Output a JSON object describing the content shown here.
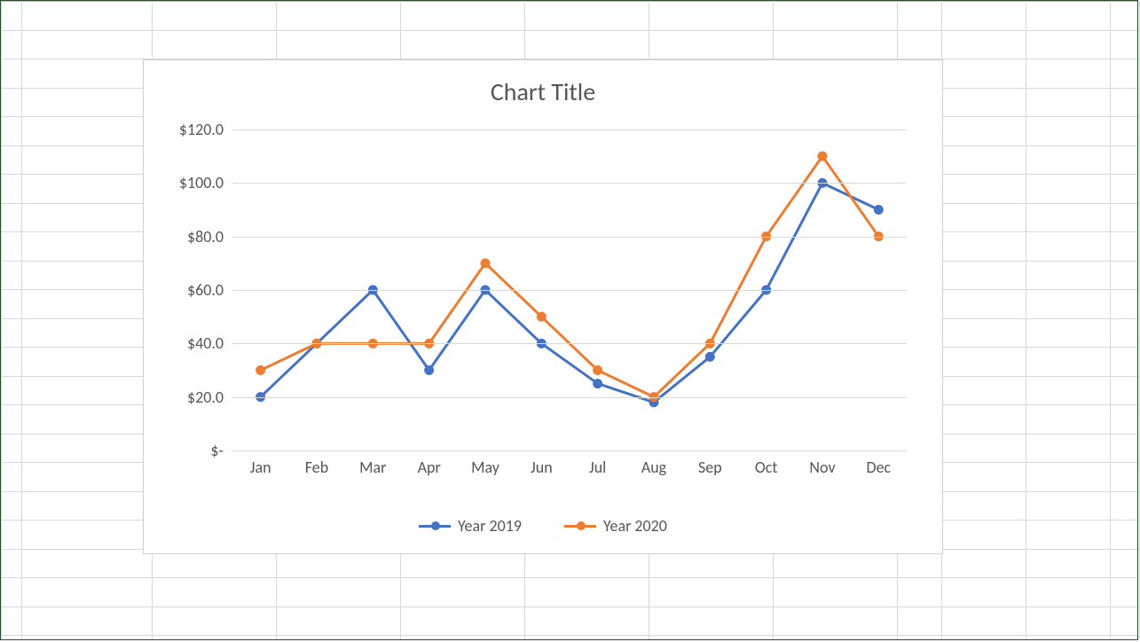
{
  "chart_data": {
    "type": "line",
    "title": "Chart Title",
    "xlabel": "",
    "ylabel": "",
    "categories": [
      "Jan",
      "Feb",
      "Mar",
      "Apr",
      "May",
      "Jun",
      "Jul",
      "Aug",
      "Sep",
      "Oct",
      "Nov",
      "Dec"
    ],
    "series": [
      {
        "name": "Year 2019",
        "color": "#4472c4",
        "values": [
          20,
          40,
          60,
          30,
          60,
          40,
          25,
          18,
          35,
          60,
          100,
          90
        ]
      },
      {
        "name": "Year 2020",
        "color": "#ed7d31",
        "values": [
          30,
          40,
          40,
          40,
          70,
          50,
          30,
          20,
          40,
          80,
          110,
          80
        ]
      }
    ],
    "yticks": [
      0,
      20,
      40,
      60,
      80,
      100,
      120
    ],
    "ytick_labels": [
      "$-",
      "$20.0",
      "$40.0",
      "$60.0",
      "$80.0",
      "$100.0",
      "$120.0"
    ],
    "ylim": [
      0,
      120
    ],
    "legend_position": "bottom"
  },
  "spreadsheet": {
    "row_height": 32.5,
    "n_rows": 22,
    "col_edges": [
      0,
      23,
      170,
      310,
      450,
      590,
      730,
      870,
      1010,
      1060,
      1155,
      1250,
      1283
    ]
  }
}
